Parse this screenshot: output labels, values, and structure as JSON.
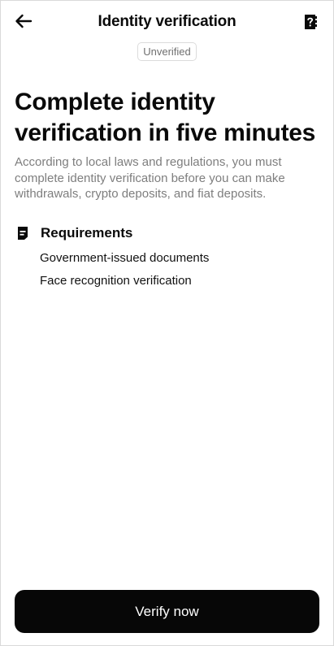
{
  "header": {
    "title": "Identity verification",
    "back_icon": "arrow-left-icon",
    "help_icon": "question-book-icon"
  },
  "status_badge": "Unverified",
  "headline": "Complete identity verification in five minutes",
  "description": "According to local laws and regulations, you must complete identity verification before you can make withdrawals, crypto deposits, and fiat deposits.",
  "requirements": {
    "icon": "document-icon",
    "title": "Requirements",
    "items": [
      "Government-issued documents",
      "Face recognition verification"
    ]
  },
  "cta": {
    "label": "Verify now"
  },
  "colors": {
    "background": "#ffffff",
    "primary_button": "#070707",
    "muted_text": "#7e7e7e"
  }
}
